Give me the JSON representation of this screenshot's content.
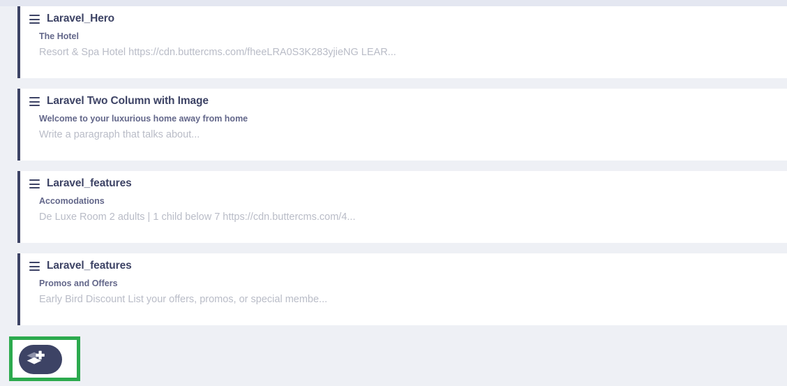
{
  "page": {
    "background_color": "#eef0f5",
    "accent_color": "#3d4365",
    "highlight_color": "#2caa4e"
  },
  "blocks": [
    {
      "drag_handle_icon": "hamburger-drag-icon",
      "title": "Laravel_Hero",
      "subtitle": "The Hotel",
      "description": "Resort & Spa Hotel https://cdn.buttercms.com/fheeLRA0S3K283yjieNG LEAR..."
    },
    {
      "drag_handle_icon": "hamburger-drag-icon",
      "title": "Laravel Two Column with Image",
      "subtitle": "Welcome to your luxurious home away from home",
      "description": "Write a paragraph that talks about..."
    },
    {
      "drag_handle_icon": "hamburger-drag-icon",
      "title": "Laravel_features",
      "subtitle": "Accomodations",
      "description": "De Luxe Room 2 adults | 1 child below 7 https://cdn.buttercms.com/4..."
    },
    {
      "drag_handle_icon": "hamburger-drag-icon",
      "title": "Laravel_features",
      "subtitle": "Promos and Offers",
      "description": "Early Bird Discount List your offers, promos, or special membe..."
    }
  ],
  "add_block": {
    "icon": "add-layers-icon",
    "label": "",
    "button_color": "#3d4365",
    "highlight_border_color": "#2caa4e"
  }
}
